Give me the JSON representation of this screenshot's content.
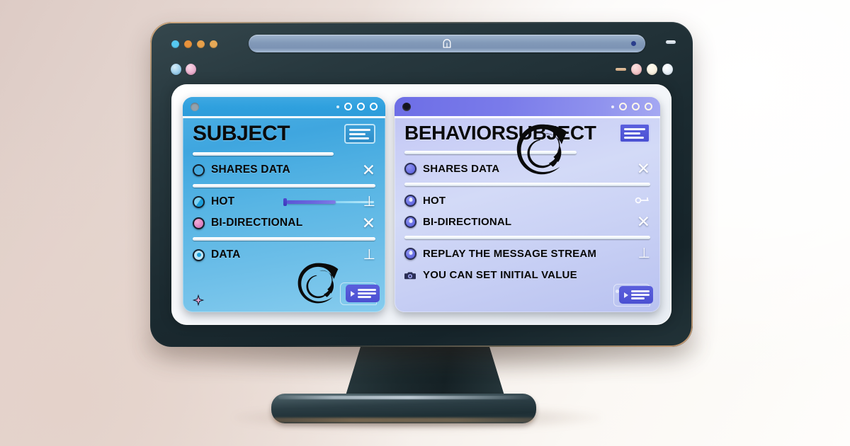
{
  "scene": {
    "background_gradient_from": "#DDCBC5",
    "background_gradient_to": "#FEFDFB",
    "monitor_bezel_color": "#1B2A30",
    "screen_color": "#FFFFFF"
  },
  "browser_chrome": {
    "traffic_lights": [
      {
        "name": "cyan",
        "color": "#56C8F0"
      },
      {
        "name": "orange-1",
        "color": "#E8923C"
      },
      {
        "name": "orange-2",
        "color": "#E8A04A"
      },
      {
        "name": "orange-3",
        "color": "#E6A957"
      }
    ],
    "address_bar": {
      "value": "",
      "placeholder": "",
      "icon": "lock-icon",
      "indicator_color": "#2B3E8C"
    },
    "minimize_label": "",
    "tab_dots": [
      {
        "name": "tab-dot-blue",
        "color": "#8FC7E8"
      },
      {
        "name": "tab-dot-pink",
        "color": "#E7A7C8"
      }
    ],
    "window_controls": [
      {
        "name": "minimize",
        "color": "#E8C9A8"
      },
      {
        "name": "control-pink",
        "color": "#F0BCC0"
      },
      {
        "name": "control-cream",
        "color": "#F7EEDC"
      },
      {
        "name": "control-white",
        "color": "#EEF4FA"
      }
    ]
  },
  "cards": [
    {
      "id": "subject",
      "title": "SUBJECT",
      "accent": "#3FA6DF",
      "titlebar_color": "#2FA0DE",
      "header_icon": "document-list-icon",
      "titlebar_left_dot": "#93A2AD",
      "titlebar_circles": 3,
      "features": [
        {
          "label": "SHARES DATA",
          "bullet": "ring",
          "end_icon": "close-x-icon",
          "end_glyph": "✕"
        },
        {
          "label": "HOT",
          "bullet": "half",
          "end_icon": "perp-icon",
          "end_glyph": "⊥",
          "control": "slider"
        },
        {
          "label": "BI-DIRECTIONAL",
          "bullet": "pink",
          "end_icon": "close-x-icon",
          "end_glyph": "✕"
        },
        {
          "label": "DATA",
          "bullet": "dotcyan",
          "end_icon": "perp-icon",
          "end_glyph": "⊥"
        }
      ],
      "slider": {
        "name": "hot-slider",
        "fill_percent": 55,
        "fill_color": "#6B66DE",
        "track_color": "#8FD8F4"
      },
      "logo": "rxjs-logo",
      "chat_icon": "chat-bubble-icon",
      "sparkle_icon": "sparkle-icon"
    },
    {
      "id": "behaviorsubject",
      "title": "BEHAVIORSUBJECT",
      "accent": "#6E73E6",
      "titlebar_color": "#7A7BEA",
      "header_icon": "document-list-icon",
      "titlebar_left_dot": "#14141E",
      "titlebar_circles": 3,
      "features": [
        {
          "label": "SHARES DATA",
          "bullet": "purple",
          "end_icon": "close-x-icon",
          "end_glyph": "✕"
        },
        {
          "label": "HOT",
          "bullet": "purpledot",
          "end_icon": "key-icon",
          "end_glyph": ""
        },
        {
          "label": "BI-DIRECTIONAL",
          "bullet": "purpledot",
          "end_icon": "close-x-icon",
          "end_glyph": "✕"
        },
        {
          "label": "REPLAY THE MESSAGE STREAM",
          "bullet": "purpledot",
          "end_icon": "perp-icon",
          "end_glyph": "⊥"
        },
        {
          "label": "YOU CAN SET INITIAL VALUE",
          "bullet": "camera",
          "end_icon": "none",
          "end_glyph": ""
        }
      ],
      "logo": "rxjs-logo",
      "chat_icon": "chat-bubble-icon"
    }
  ]
}
